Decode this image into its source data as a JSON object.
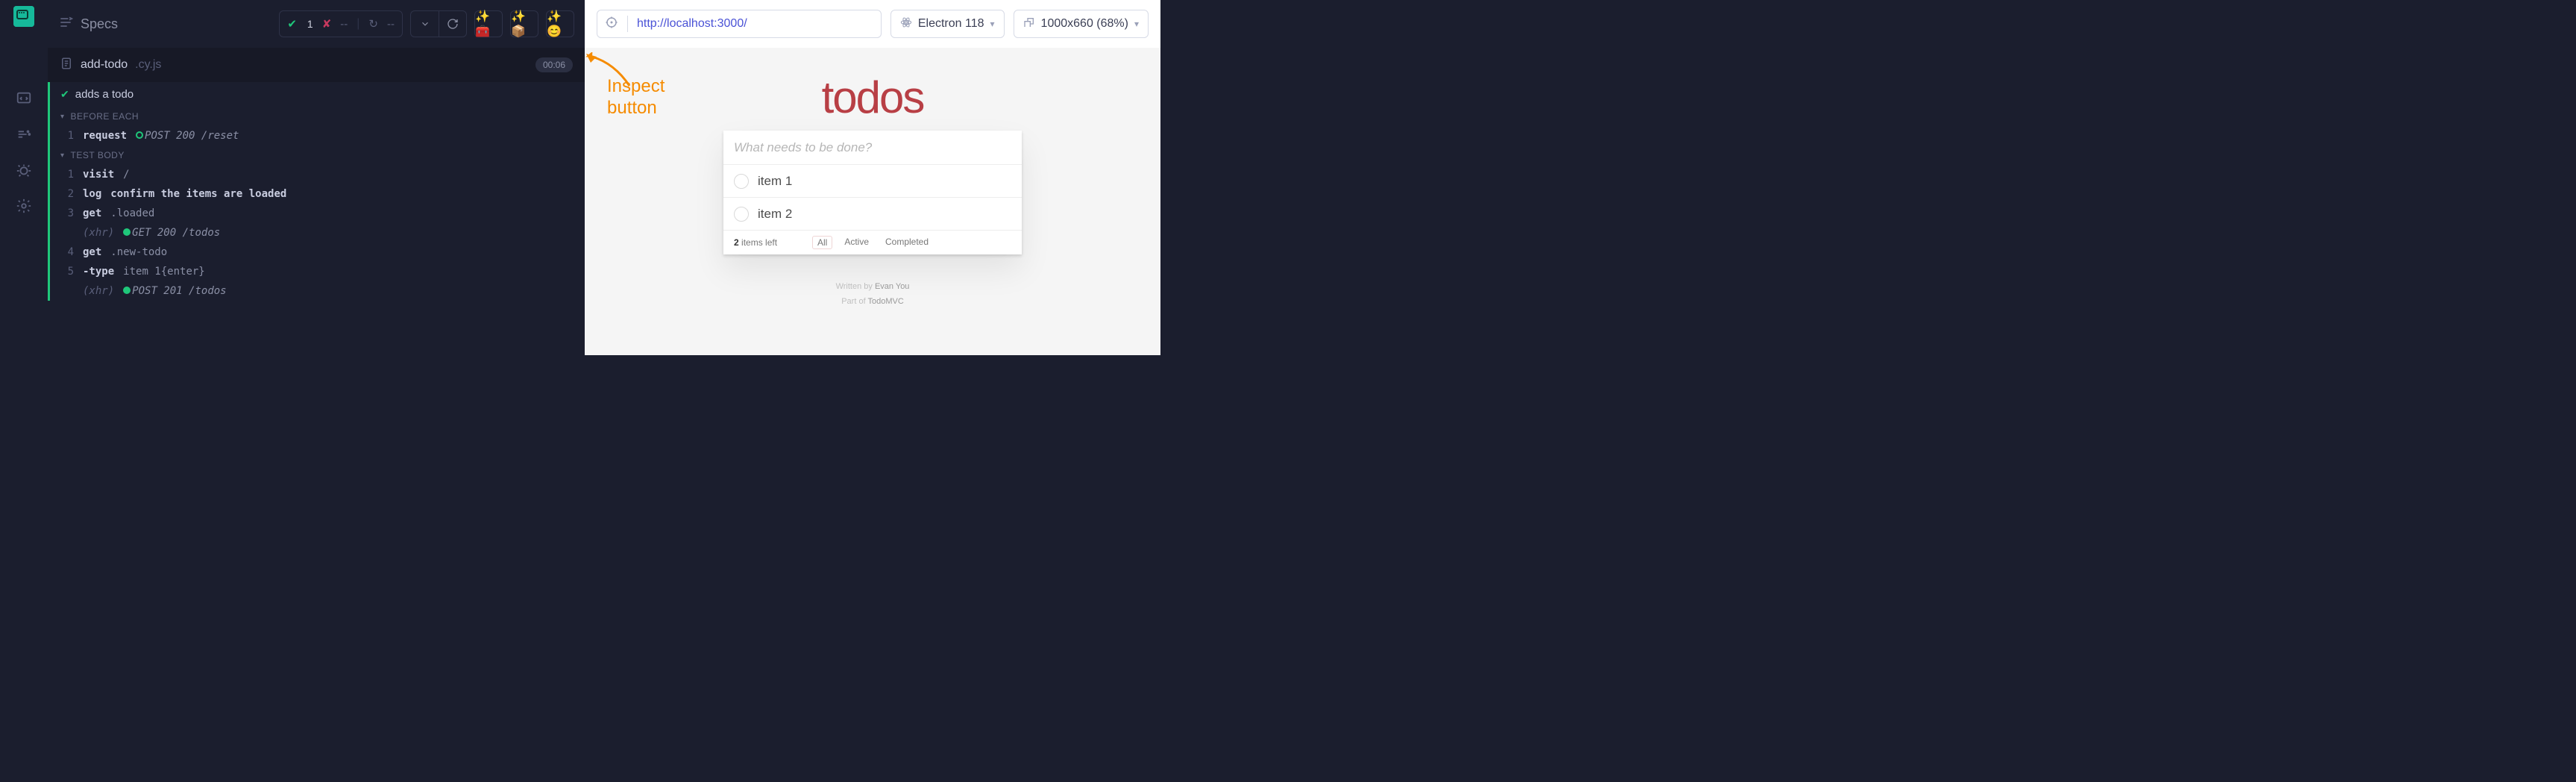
{
  "rail": {},
  "header": {
    "title": "Specs",
    "stats": {
      "pass": "1",
      "fail": "--"
    }
  },
  "spec": {
    "name": "add-todo",
    "ext": ".cy.js",
    "time": "00:06"
  },
  "test": {
    "title": "adds a todo",
    "before_label": "BEFORE EACH",
    "body_label": "TEST BODY",
    "before": [
      {
        "num": "1",
        "name": "request",
        "status": "POST 200",
        "path": "/reset"
      }
    ],
    "body": [
      {
        "num": "1",
        "name": "visit",
        "arg": "/"
      },
      {
        "num": "2",
        "name": "log",
        "msg": "confirm the items are loaded"
      },
      {
        "num": "3",
        "name": "get",
        "arg": ".loaded"
      },
      {
        "xhr": "(xhr)",
        "status": "GET 200",
        "path": "/todos"
      },
      {
        "num": "4",
        "name": "get",
        "arg": ".new-todo"
      },
      {
        "num": "5",
        "name": "-type",
        "arg": "item 1{enter}"
      },
      {
        "xhr": "(xhr)",
        "status": "POST 201",
        "path": "/todos"
      }
    ]
  },
  "aut": {
    "url": "http://localhost:3000/",
    "browser": "Electron 118",
    "viewport": "1000x660 (68%)"
  },
  "todo": {
    "title": "todos",
    "placeholder": "What needs to be done?",
    "items": [
      "item 1",
      "item 2"
    ],
    "count_num": "2",
    "count_txt": " items left",
    "filters": {
      "all": "All",
      "active": "Active",
      "completed": "Completed"
    },
    "credits_written": "Written by ",
    "credits_author": "Evan You",
    "credits_part": "Part of ",
    "credits_proj": "TodoMVC"
  },
  "annotation": {
    "line1": "Inspect",
    "line2": "button"
  }
}
